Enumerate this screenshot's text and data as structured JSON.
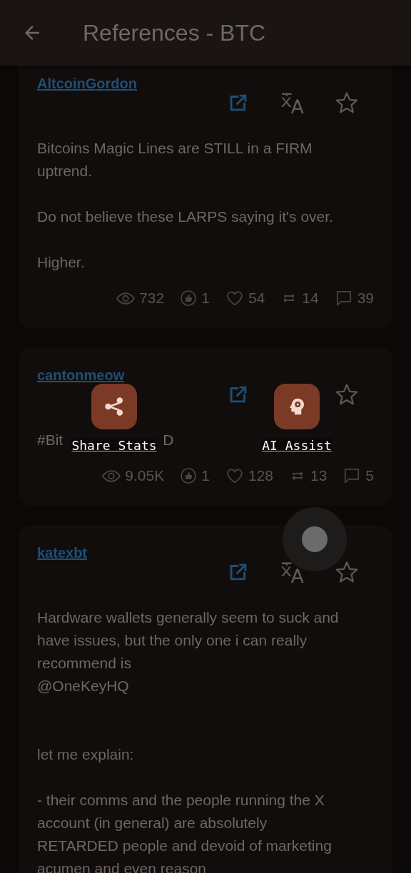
{
  "app_bar": {
    "title": "References - BTC"
  },
  "posts": [
    {
      "author": "AltcoinGordon",
      "translate": true,
      "text": "Bitcoins Magic Lines are STILL in a FIRM uptrend.\n\nDo not believe these LARPS saying it's over.\n\nHigher.",
      "stats": [
        {
          "kind": "views",
          "value": "732"
        },
        {
          "kind": "upvotes",
          "value": "1"
        },
        {
          "kind": "likes",
          "value": "54"
        },
        {
          "kind": "reposts",
          "value": "14"
        },
        {
          "kind": "replies",
          "value": "39"
        }
      ]
    },
    {
      "author": "cantonmeow",
      "translate": false,
      "text": [
        "#Bit",
        "D"
      ],
      "stats": [
        {
          "kind": "views",
          "value": "9.05K"
        },
        {
          "kind": "upvotes",
          "value": "1"
        },
        {
          "kind": "likes",
          "value": "128"
        },
        {
          "kind": "reposts",
          "value": "13"
        },
        {
          "kind": "replies",
          "value": "5"
        }
      ]
    },
    {
      "author": "katexbt",
      "translate": true,
      "text": "Hardware wallets generally seem to suck and have issues, but the only one i can really recommend is\n@OneKeyHQ\n\n\nlet me explain:\n\n- their comms and the people running the X account (in general) are absolutely RETARDED people and devoid of marketing acumen and even reason"
    }
  ],
  "overlay_actions": [
    {
      "kind": "share",
      "label": "Share Stats"
    },
    {
      "kind": "ai",
      "label": "AI Assist"
    }
  ]
}
